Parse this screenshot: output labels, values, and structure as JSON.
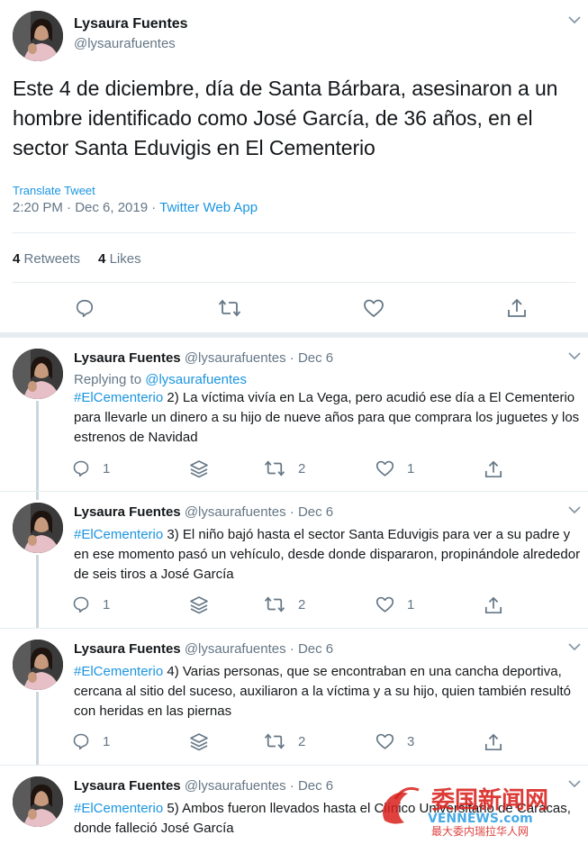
{
  "main_tweet": {
    "name": "Lysaura Fuentes",
    "handle": "@lysaurafuentes",
    "text": "Este 4 de diciembre, día de Santa Bárbara, asesinaron a un hombre identificado como José García, de 36 años, en el sector Santa Eduvigis en El Cementerio",
    "translate": "Translate Tweet",
    "timestamp": "2:20 PM · Dec 6, 2019 · ",
    "app": "Twitter Web App",
    "retweets_count": "4",
    "retweets_label": "Retweets",
    "likes_count": "4",
    "likes_label": "Likes"
  },
  "replies": [
    {
      "name": "Lysaura Fuentes",
      "handle_date": "@lysaurafuentes · Dec 6",
      "replying_prefix": "Replying to ",
      "replying_to": "@lysaurafuentes",
      "hashtag": "#ElCementerio",
      "text": " 2) La víctima vivía en La Vega, pero acudió ese día a El Cementerio para llevarle un dinero a su hijo de nueve años para que comprara los juguetes y los estrenos de Navidad",
      "reply_count": "1",
      "retweet_count": "2",
      "like_count": "1"
    },
    {
      "name": "Lysaura Fuentes",
      "handle_date": "@lysaurafuentes · Dec 6",
      "hashtag": "#ElCementerio",
      "text": " 3) El niño bajó hasta el sector Santa Eduvigis para ver a su padre y en ese momento pasó un vehículo, desde donde dispararon, propinándole alrededor de seis tiros a José García",
      "reply_count": "1",
      "retweet_count": "2",
      "like_count": "1"
    },
    {
      "name": "Lysaura Fuentes",
      "handle_date": "@lysaurafuentes · Dec 6",
      "hashtag": "#ElCementerio",
      "text": " 4) Varias personas, que se encontraban en una cancha deportiva, cercana al sitio del suceso, auxiliaron a la víctima y a su hijo, quien también resultó con heridas en las piernas",
      "reply_count": "1",
      "retweet_count": "2",
      "like_count": "3"
    },
    {
      "name": "Lysaura Fuentes",
      "handle_date": "@lysaurafuentes · Dec 6",
      "hashtag": "#ElCementerio",
      "text": " 5) Ambos fueron llevados hasta el Clínico Universitario de Caracas, donde falleció José García"
    }
  ],
  "watermark": {
    "title": "委国新闻网",
    "domain": "VENNEWS.com",
    "subtitle": "最大委内瑞拉华人网"
  },
  "colors": {
    "link": "#1b95e0",
    "muted": "#657786",
    "divider": "#e6ecf0",
    "watermark_red": "#d8201c"
  }
}
